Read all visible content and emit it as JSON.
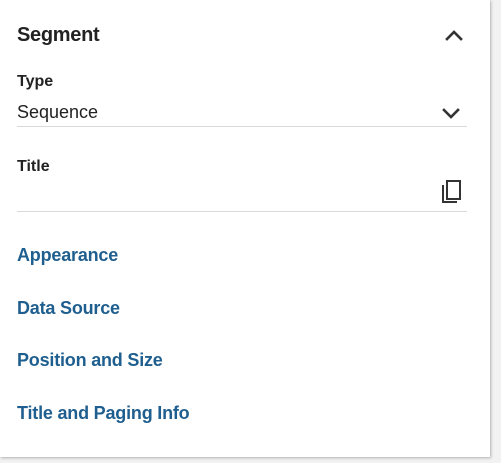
{
  "panel": {
    "title": "Segment",
    "collapse_icon": "chevron-up-icon"
  },
  "type_field": {
    "label": "Type",
    "value": "Sequence",
    "dropdown_icon": "chevron-down-icon"
  },
  "title_field": {
    "label": "Title",
    "value": "",
    "copy_icon": "copy-icon"
  },
  "sections": [
    {
      "label": "Appearance"
    },
    {
      "label": "Data Source"
    },
    {
      "label": "Position and Size"
    },
    {
      "label": "Title and Paging Info"
    }
  ],
  "colors": {
    "link": "#1f5f8f",
    "text": "#222222",
    "divider": "#d9d9d9"
  }
}
